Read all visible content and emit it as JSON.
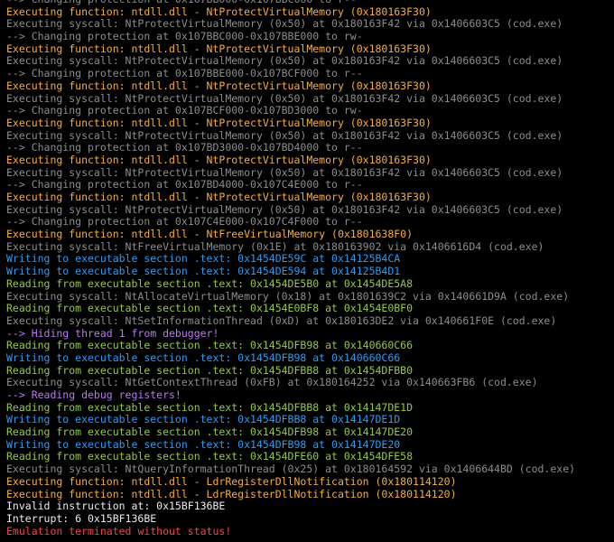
{
  "terminal": {
    "colors": {
      "func": "#f5ad3e",
      "syscall": "#8c8c8c",
      "protect": "#8c8c8c",
      "write": "#2e9bf0",
      "read": "#96c746",
      "hide": "#b978f0",
      "invalid": "#ececec",
      "error": "#f04848"
    },
    "lines": [
      {
        "type": "protect",
        "text": "--> Changing protection at 0x107BB000-0x107BBC000 to r--"
      },
      {
        "type": "func",
        "text": "Executing function: ntdll.dll - NtProtectVirtualMemory (0x180163F30)"
      },
      {
        "type": "syscall",
        "text": "Executing syscall: NtProtectVirtualMemory (0x50) at 0x180163F42 via 0x1406603C5 (cod.exe)"
      },
      {
        "type": "protect",
        "text": "--> Changing protection at 0x107BBC000-0x107BBE000 to rw-"
      },
      {
        "type": "func",
        "text": "Executing function: ntdll.dll - NtProtectVirtualMemory (0x180163F30)"
      },
      {
        "type": "syscall",
        "text": "Executing syscall: NtProtectVirtualMemory (0x50) at 0x180163F42 via 0x1406603C5 (cod.exe)"
      },
      {
        "type": "protect",
        "text": "--> Changing protection at 0x107BBE000-0x107BCF000 to r--"
      },
      {
        "type": "func",
        "text": "Executing function: ntdll.dll - NtProtectVirtualMemory (0x180163F30)"
      },
      {
        "type": "syscall",
        "text": "Executing syscall: NtProtectVirtualMemory (0x50) at 0x180163F42 via 0x1406603C5 (cod.exe)"
      },
      {
        "type": "protect",
        "text": "--> Changing protection at 0x107BCF000-0x107BD3000 to rw-"
      },
      {
        "type": "func",
        "text": "Executing function: ntdll.dll - NtProtectVirtualMemory (0x180163F30)"
      },
      {
        "type": "syscall",
        "text": "Executing syscall: NtProtectVirtualMemory (0x50) at 0x180163F42 via 0x1406603C5 (cod.exe)"
      },
      {
        "type": "protect",
        "text": "--> Changing protection at 0x107BD3000-0x107BD4000 to r--"
      },
      {
        "type": "func",
        "text": "Executing function: ntdll.dll - NtProtectVirtualMemory (0x180163F30)"
      },
      {
        "type": "syscall",
        "text": "Executing syscall: NtProtectVirtualMemory (0x50) at 0x180163F42 via 0x1406603C5 (cod.exe)"
      },
      {
        "type": "protect",
        "text": "--> Changing protection at 0x107BD4000-0x107C4E000 to r--"
      },
      {
        "type": "func",
        "text": "Executing function: ntdll.dll - NtProtectVirtualMemory (0x180163F30)"
      },
      {
        "type": "syscall",
        "text": "Executing syscall: NtProtectVirtualMemory (0x50) at 0x180163F42 via 0x1406603C5 (cod.exe)"
      },
      {
        "type": "protect",
        "text": "--> Changing protection at 0x107C4E000-0x107C4F000 to r--"
      },
      {
        "type": "func",
        "text": "Executing function: ntdll.dll - NtFreeVirtualMemory (0x1801638F0)"
      },
      {
        "type": "syscall",
        "text": "Executing syscall: NtFreeVirtualMemory (0x1E) at 0x180163902 via 0x1406616D4 (cod.exe)"
      },
      {
        "type": "write",
        "text": "Writing to executable section .text: 0x1454DE59C at 0x14125B4CA"
      },
      {
        "type": "write",
        "text": "Writing to executable section .text: 0x1454DE594 at 0x14125B4D1"
      },
      {
        "type": "read",
        "text": "Reading from executable section .text: 0x1454DE5B0 at 0x1454DE5A8"
      },
      {
        "type": "syscall",
        "text": "Executing syscall: NtAllocateVirtualMemory (0x18) at 0x1801639C2 via 0x140661D9A (cod.exe)"
      },
      {
        "type": "read",
        "text": "Reading from executable section .text: 0x1454E0BF8 at 0x1454E0BF0"
      },
      {
        "type": "syscall",
        "text": "Executing syscall: NtSetInformationThread (0xD) at 0x180163DE2 via 0x140661F0E (cod.exe)"
      },
      {
        "type": "hide",
        "text": "--> Hiding thread 1 from debugger!"
      },
      {
        "type": "read",
        "text": "Reading from executable section .text: 0x1454DFB98 at 0x140660C66"
      },
      {
        "type": "write",
        "text": "Writing to executable section .text: 0x1454DFB98 at 0x140660C66"
      },
      {
        "type": "read",
        "text": "Reading from executable section .text: 0x1454DFBB8 at 0x1454DFBB0"
      },
      {
        "type": "syscall",
        "text": "Executing syscall: NtGetContextThread (0xFB) at 0x180164252 via 0x140663FB6 (cod.exe)"
      },
      {
        "type": "hide",
        "text": "--> Reading debug registers!"
      },
      {
        "type": "read",
        "text": "Reading from executable section .text: 0x1454DFBB8 at 0x14147DE1D"
      },
      {
        "type": "write",
        "text": "Writing to executable section .text: 0x1454DFBB8 at 0x14147DE1D"
      },
      {
        "type": "read",
        "text": "Reading from executable section .text: 0x1454DFB98 at 0x14147DE20"
      },
      {
        "type": "write",
        "text": "Writing to executable section .text: 0x1454DFB98 at 0x14147DE20"
      },
      {
        "type": "read",
        "text": "Reading from executable section .text: 0x1454DFE60 at 0x1454DFE58"
      },
      {
        "type": "syscall",
        "text": "Executing syscall: NtQueryInformationThread (0x25) at 0x180164592 via 0x1406644BD (cod.exe)"
      },
      {
        "type": "func",
        "text": "Executing function: ntdll.dll - LdrRegisterDllNotification (0x180114120)"
      },
      {
        "type": "func",
        "text": "Executing function: ntdll.dll - LdrRegisterDllNotification (0x180114120)"
      },
      {
        "type": "invalid",
        "text": "Invalid instruction at: 0x15BF136BE"
      },
      {
        "type": "invalid",
        "text": "Interrupt: 6 0x15BF136BE"
      },
      {
        "type": "error",
        "text": "Emulation terminated without status!"
      }
    ]
  }
}
